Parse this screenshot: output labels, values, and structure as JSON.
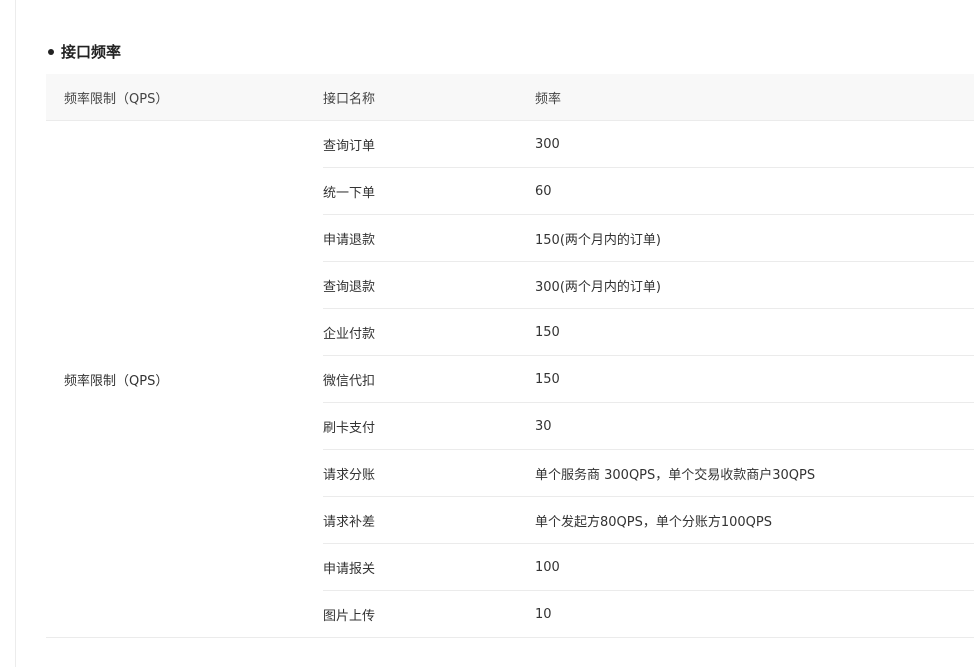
{
  "section": {
    "title": "接口频率"
  },
  "table": {
    "headers": [
      "频率限制（QPS）",
      "接口名称",
      "频率"
    ],
    "group_label": "频率限制（QPS）",
    "rows": [
      {
        "name": "查询订单",
        "rate": "300"
      },
      {
        "name": "统一下单",
        "rate": "60"
      },
      {
        "name": "申请退款",
        "rate": "150(两个月内的订单)"
      },
      {
        "name": "查询退款",
        "rate": "300(两个月内的订单)"
      },
      {
        "name": "企业付款",
        "rate": "150"
      },
      {
        "name": "微信代扣",
        "rate": "150"
      },
      {
        "name": "刷卡支付",
        "rate": "30"
      },
      {
        "name": "请求分账",
        "rate": "单个服务商 300QPS，单个交易收款商户30QPS"
      },
      {
        "name": "请求补差",
        "rate": "单个发起方80QPS，单个分账方100QPS"
      },
      {
        "name": "申请报关",
        "rate": "100"
      },
      {
        "name": "图片上传",
        "rate": "10"
      }
    ]
  }
}
